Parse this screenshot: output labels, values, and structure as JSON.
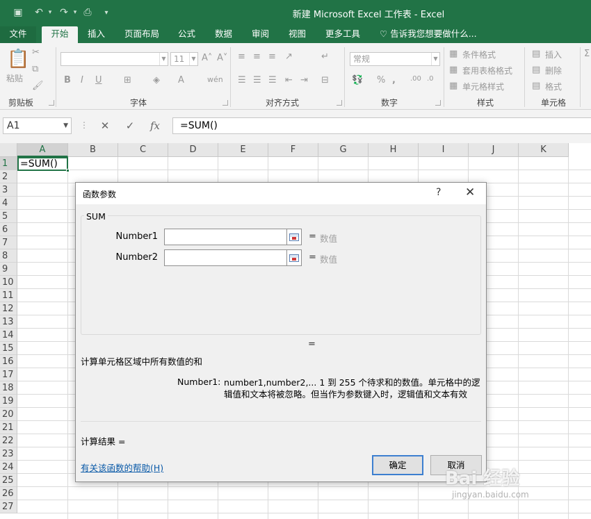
{
  "window": {
    "title": "新建 Microsoft Excel 工作表 - Excel",
    "quick_access": [
      "save-icon",
      "undo-icon",
      "redo-icon",
      "print-preview-icon",
      "customize-icon"
    ]
  },
  "tabs": {
    "file": "文件",
    "home": "开始",
    "insert": "插入",
    "page_layout": "页面布局",
    "formulas": "公式",
    "data": "数据",
    "review": "审阅",
    "view": "视图",
    "more_tools": "更多工具",
    "tell_me": "告诉我您想要做什么..."
  },
  "ribbon": {
    "clipboard": {
      "label": "剪贴板",
      "paste": "粘贴"
    },
    "font": {
      "label": "字体",
      "font_name": "",
      "font_size": "11",
      "bold": "B",
      "italic": "I",
      "underline": "U"
    },
    "alignment": {
      "label": "对齐方式"
    },
    "number": {
      "label": "数字",
      "format": "常规"
    },
    "styles": {
      "label": "样式",
      "conditional": "条件格式",
      "table": "套用表格格式",
      "cell_styles": "单元格样式"
    },
    "cells": {
      "label": "单元格",
      "insert": "插入",
      "delete": "删除",
      "format": "格式"
    }
  },
  "formula_bar": {
    "name_box": "A1",
    "fx": "fx",
    "formula": "=SUM()"
  },
  "sheet": {
    "columns": [
      "A",
      "B",
      "C",
      "D",
      "E",
      "F",
      "G",
      "H",
      "I",
      "J",
      "K"
    ],
    "rows": [
      "1",
      "2",
      "3",
      "4",
      "5",
      "6",
      "7",
      "8",
      "9",
      "10",
      "11",
      "12",
      "13",
      "14",
      "15",
      "16",
      "17",
      "18",
      "19",
      "20",
      "21",
      "22",
      "23",
      "24",
      "25",
      "26",
      "27"
    ],
    "a1_value": "=SUM()"
  },
  "dialog": {
    "title": "函数参数",
    "help": "?",
    "close": "✕",
    "function_name": "SUM",
    "args": [
      {
        "label": "Number1",
        "eq": "=",
        "value": "数值"
      },
      {
        "label": "Number2",
        "eq": "=",
        "value": "数值"
      }
    ],
    "result_eq": "=",
    "description": "计算单元格区域中所有数值的和",
    "param_name": "Number1:",
    "param_desc": "number1,number2,... 1 到 255 个待求和的数值。单元格中的逻辑值和文本将被忽略。但当作为参数键入时，逻辑值和文本有效",
    "calc_result": "计算结果 =",
    "help_link": "有关该函数的帮助(H)",
    "ok": "确定",
    "cancel": "取消"
  },
  "watermark": {
    "text": "Bai 经验",
    "sub": "jingyan.baidu.com"
  }
}
